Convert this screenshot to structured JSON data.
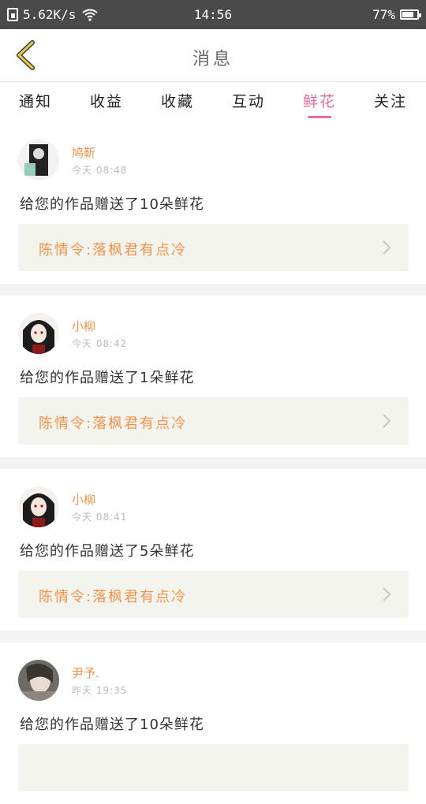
{
  "status_bar": {
    "speed": "5.62K/s",
    "time": "14:56",
    "battery_percent": "77%",
    "battery_level": 0.77
  },
  "header": {
    "title": "消息"
  },
  "tabs": [
    {
      "label": "通知",
      "active": false
    },
    {
      "label": "收益",
      "active": false
    },
    {
      "label": "收藏",
      "active": false
    },
    {
      "label": "互动",
      "active": false
    },
    {
      "label": "鲜花",
      "active": true
    },
    {
      "label": "关注",
      "active": false
    }
  ],
  "messages": [
    {
      "user": "鸠靳",
      "time": "今天 08:48",
      "text": "给您的作品赠送了10朵鲜花",
      "work": "陈情令:落枫君有点冷",
      "avatar": "avatar-1"
    },
    {
      "user": "小柳",
      "time": "今天 08:42",
      "text": "给您的作品赠送了1朵鲜花",
      "work": "陈情令:落枫君有点冷",
      "avatar": "avatar-2"
    },
    {
      "user": "小柳",
      "time": "今天 08:41",
      "text": "给您的作品赠送了5朵鲜花",
      "work": "陈情令:落枫君有点冷",
      "avatar": "avatar-2"
    },
    {
      "user": "尹予.",
      "time": "昨天 19:35",
      "text": "给您的作品赠送了10朵鲜花",
      "work": "",
      "avatar": "avatar-3"
    }
  ],
  "colors": {
    "accent_pink": "#e36ba0",
    "accent_orange": "#f0924c",
    "back_yellow": "#e8c94a"
  }
}
